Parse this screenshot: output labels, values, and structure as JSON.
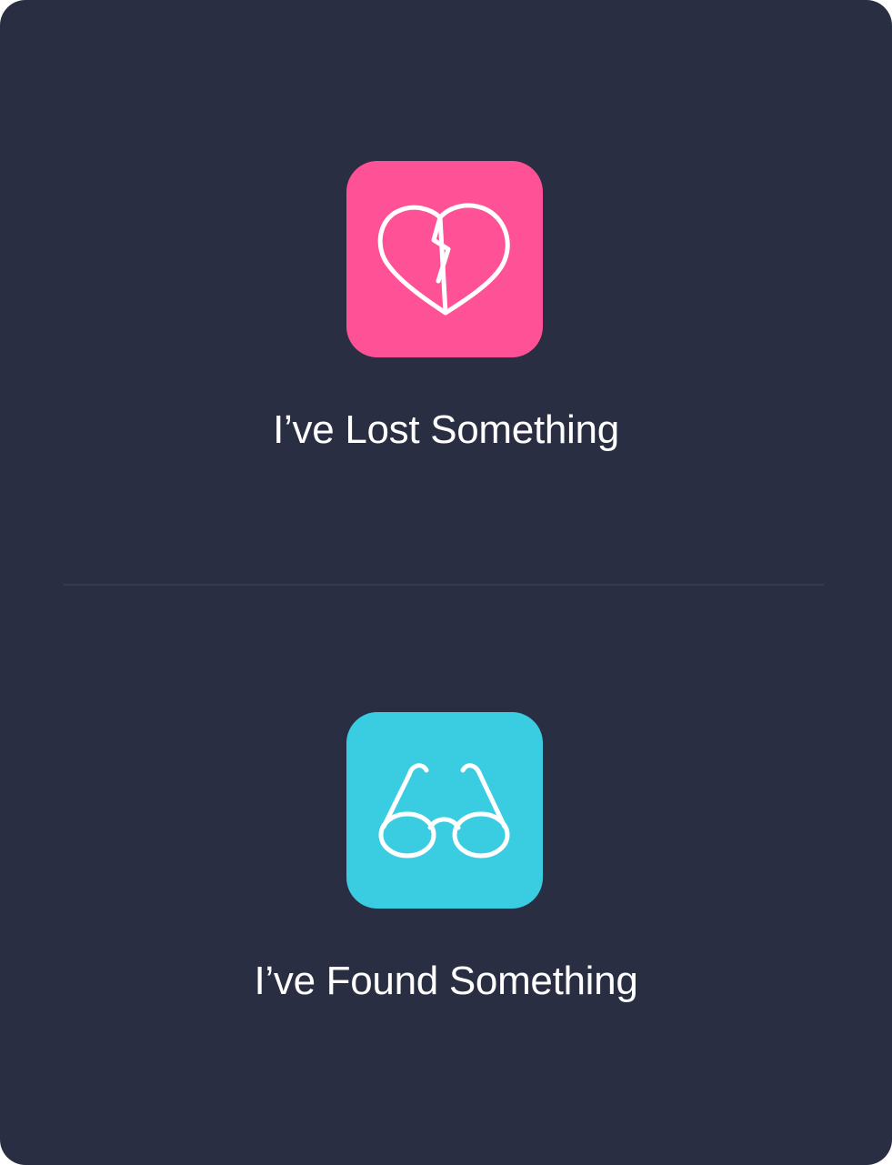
{
  "options": [
    {
      "id": "lost",
      "label": "I’ve Lost Something",
      "icon": "broken-heart-icon",
      "color": "#ff5196"
    },
    {
      "id": "found",
      "label": "I’ve Found Something",
      "icon": "glasses-icon",
      "color": "#3acce1"
    }
  ],
  "theme": {
    "background": "#2a2e43",
    "divider": "#353a51",
    "text": "#ffffff"
  }
}
